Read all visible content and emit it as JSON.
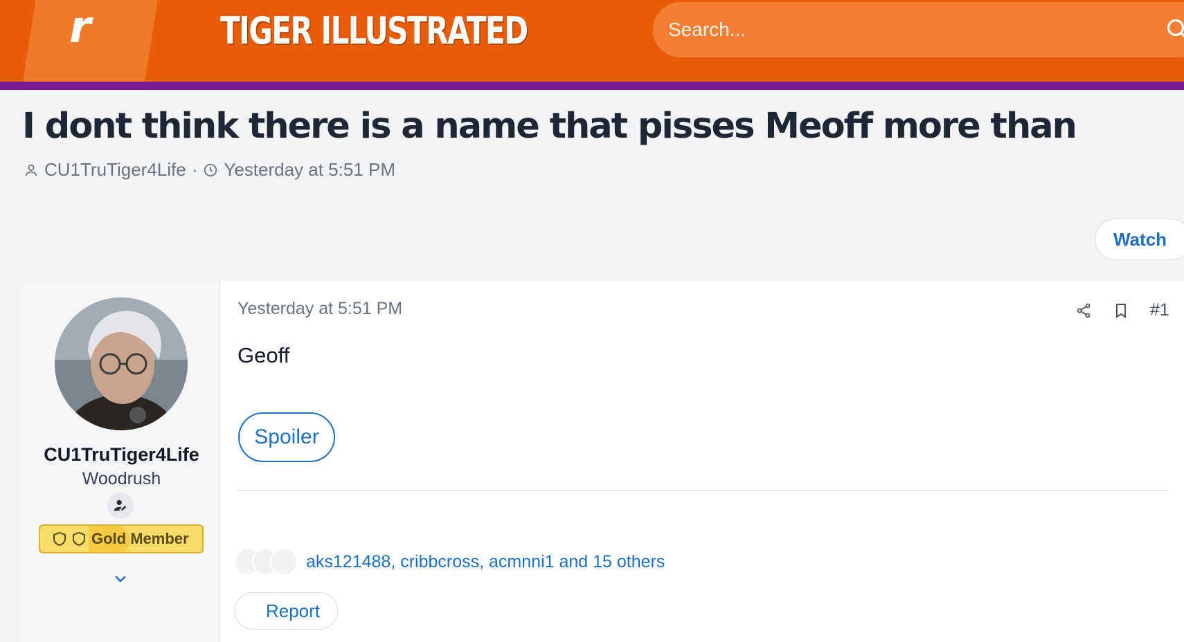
{
  "header": {
    "logo_letter": "r",
    "site_title": "TIGER ILLUSTRATED",
    "search_placeholder": "Search...",
    "brand_color": "#e85d0a",
    "stripe_color": "#7a1a8f"
  },
  "thread": {
    "title": "I dont think there is a name that pisses Meoff more than",
    "author": "CU1TruTiger4Life",
    "separator": "·",
    "timestamp": "Yesterday at 5:51 PM",
    "watch_label": "Watch"
  },
  "post": {
    "user": {
      "name": "CU1TruTiger4Life",
      "title": "Woodrush",
      "banner": "Gold Member"
    },
    "date": "Yesterday at 5:51 PM",
    "number": "#1",
    "text": "Geoff",
    "spoiler_label": "Spoiler",
    "reactions_text": "aks121488, cribbcross, acmnni1 and 15 others",
    "report_label": "Report"
  },
  "icons": [
    "search-icon",
    "user-icon",
    "clock-icon",
    "share-icon",
    "bookmark-icon",
    "user-edit-icon",
    "shield-icon",
    "chevron-down-icon"
  ]
}
